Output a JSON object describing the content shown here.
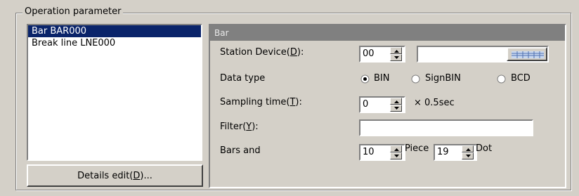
{
  "group_title": "Operation parameter",
  "list_items": [
    "Bar BAR000",
    "Break line LNE000"
  ],
  "details_button": {
    "text": "Details edit(",
    "mnemonic": "D",
    "suffix": ")..."
  },
  "panel_header": "Bar",
  "station_device": {
    "label": "Station Device(",
    "mnemonic": "D",
    "suffix": "):",
    "value": "00",
    "text_value": ""
  },
  "data_type": {
    "label": "Data type",
    "options": [
      "BIN",
      "SignBIN",
      "BCD"
    ],
    "selected": "BIN"
  },
  "sampling_time": {
    "label": "Sampling time(",
    "mnemonic": "T",
    "suffix": "):",
    "value": "0",
    "unit": "× 0.5sec"
  },
  "filter": {
    "label": "Filter(",
    "mnemonic": "Y",
    "suffix": "):",
    "value": ""
  },
  "bars": {
    "label": "Bars and",
    "piece_value": "10",
    "piece_unit": "Piece",
    "dot_value": "19",
    "dot_unit": "Dot"
  },
  "colors": {
    "face": "#d4d0c8",
    "selection": "#0a246a",
    "header": "#808080"
  }
}
